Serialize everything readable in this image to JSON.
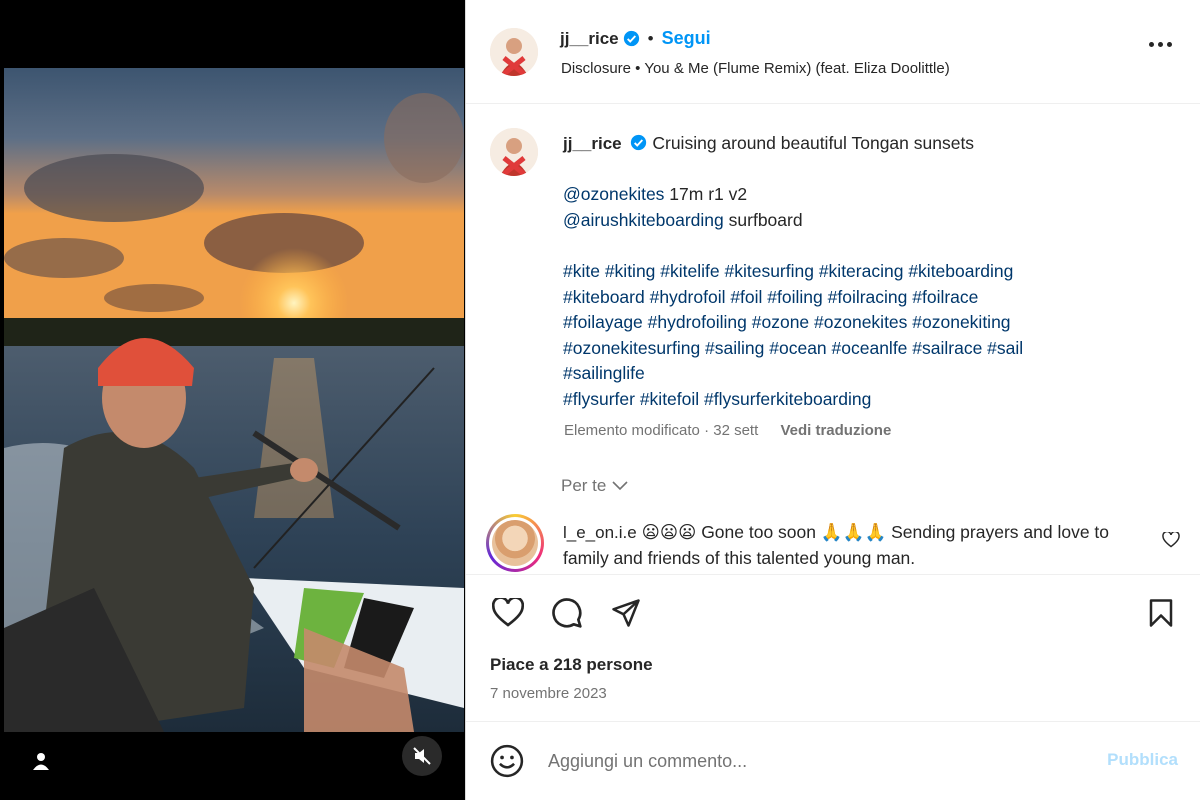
{
  "post": {
    "author": "jj__rice",
    "separator": "•",
    "follow_label": "Segui",
    "audio": "Disclosure • You & Me (Flume Remix) (feat. Eliza Doolittle)",
    "more_label": "more-options"
  },
  "caption": {
    "username": "jj__rice",
    "first_line": "Cruising around beautiful Tongan sunsets",
    "mention1": "@ozonekites",
    "mention1_rest": " 17m r1 v2",
    "mention2": "@airushkiteboarding",
    "mention2_rest": " surfboard",
    "hashtags_line1": "#kite #kiting #kitelife #kitesurfing #kiteracing #kiteboarding",
    "hashtags_line2": "#kiteboard #hydrofoil #foil #foiling #foilracing #foilrace",
    "hashtags_line3": "#foilayage #hydrofoiling #ozone #ozonekites #ozonekiting",
    "hashtags_line4": "#ozonekitesurfing #sailing #ocean #oceanlfe #sailrace #sail",
    "hashtags_line5": "#sailinglife",
    "hashtags_line6": "#flysurfer #kitefoil #flysurferkiteboarding",
    "edited": "Elemento modificato · 32 sett",
    "translate": "Vedi traduzione",
    "for_you": "Per te"
  },
  "comment": {
    "username": "l_e_on.i.e",
    "text": " 😦😦😦 Gone too soon 🙏🙏🙏 Sending prayers and love to family and friends of this talented young man."
  },
  "actions": {
    "likes": "Piace a 218 persone",
    "date": "7 novembre 2023"
  },
  "composer": {
    "placeholder": "Aggiungi un commento...",
    "publish": "Pubblica"
  },
  "colors": {
    "accent": "#0095f6",
    "hashtag": "#00376b",
    "muted": "#737373",
    "publish_disabled": "#b2dffc"
  },
  "icons": [
    "user-tag-icon",
    "mute-icon",
    "verified-badge-icon",
    "more-icon",
    "chevron-down-icon",
    "heart-icon",
    "comment-icon",
    "share-icon",
    "bookmark-icon",
    "emoji-icon"
  ]
}
